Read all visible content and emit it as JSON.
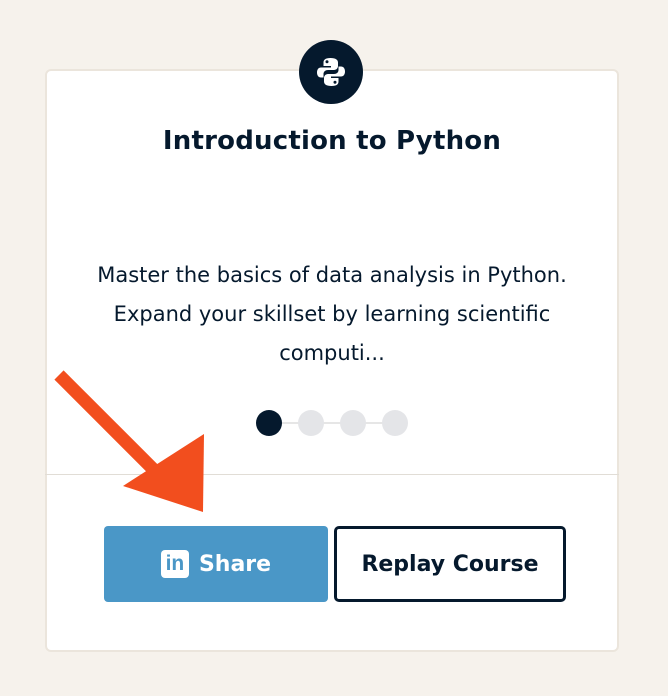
{
  "course": {
    "icon": "python-logo-icon",
    "title": "Introduction to Python",
    "description": "Master the basics of data analysis in Python. Expand your skillset by learning scientific computi..."
  },
  "carousel": {
    "total": 4,
    "active_index": 0
  },
  "actions": {
    "share_label": "Share",
    "share_icon": "linkedin-icon",
    "replay_label": "Replay Course"
  },
  "colors": {
    "navy": "#05192d",
    "share_blue": "#4a97c7",
    "arrow_red": "#f24e1e",
    "background": "#f6f2ec"
  }
}
